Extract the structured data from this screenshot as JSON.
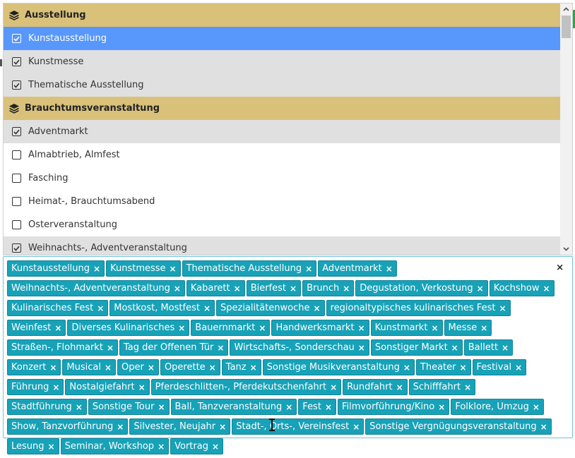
{
  "groups": [
    {
      "label": "Ausstellung",
      "options": [
        {
          "label": "Kunstausstellung",
          "checked": true,
          "highlighted": true
        },
        {
          "label": "Kunstmesse",
          "checked": true
        },
        {
          "label": "Thematische Ausstellung",
          "checked": true
        }
      ]
    },
    {
      "label": "Brauchtumsveranstaltung",
      "options": [
        {
          "label": "Adventmarkt",
          "checked": true
        },
        {
          "label": "Almabtrieb, Almfest",
          "checked": false
        },
        {
          "label": "Fasching",
          "checked": false
        },
        {
          "label": "Heimat-, Brauchtumsabend",
          "checked": false
        },
        {
          "label": "Osterveranstaltung",
          "checked": false
        },
        {
          "label": "Weihnachts-, Adventveranstaltung",
          "checked": true
        }
      ]
    }
  ],
  "selected_tags": [
    "Kunstausstellung",
    "Kunstmesse",
    "Thematische Ausstellung",
    "Adventmarkt",
    "Weihnachts-, Adventveranstaltung",
    "Kabarett",
    "Bierfest",
    "Brunch",
    "Degustation, Verkostung",
    "Kochshow",
    "Kulinarisches Fest",
    "Mostkost, Mostfest",
    "Spezialitätenwoche",
    "regionaltypisches kulinarisches Fest",
    "Weinfest",
    "Diverses Kulinarisches",
    "Bauernmarkt",
    "Handwerksmarkt",
    "Kunstmarkt",
    "Messe",
    "Straßen-, Flohmarkt",
    "Tag der Offenen Tür",
    "Wirtschafts-, Sonderschau",
    "Sonstiger Markt",
    "Ballett",
    "Konzert",
    "Musical",
    "Oper",
    "Operette",
    "Tanz",
    "Sonstige Musikveranstaltung",
    "Theater",
    "Festival",
    "Führung",
    "Nostalgiefahrt",
    "Pferdeschlitten-, Pferdekutschenfahrt",
    "Rundfahrt",
    "Schifffahrt",
    "Stadtführung",
    "Sonstige Tour",
    "Ball, Tanzveranstaltung",
    "Fest",
    "Filmvorführung/Kino",
    "Folklore, Umzug",
    "Show, Tanzvorführung",
    "Silvester, Neujahr",
    "Stadt-, Orts-, Vereinsfest",
    "Sonstige Vergnügungsveranstaltung",
    "Lesung",
    "Seminar, Workshop",
    "Vortrag"
  ],
  "tag_remove_glyph": "×",
  "clear_all_glyph": "×",
  "colors": {
    "group_header": "#d9c17a",
    "highlight": "#5897fb",
    "selected_option": "#e0e0e0",
    "tag": "#17a2b8"
  }
}
